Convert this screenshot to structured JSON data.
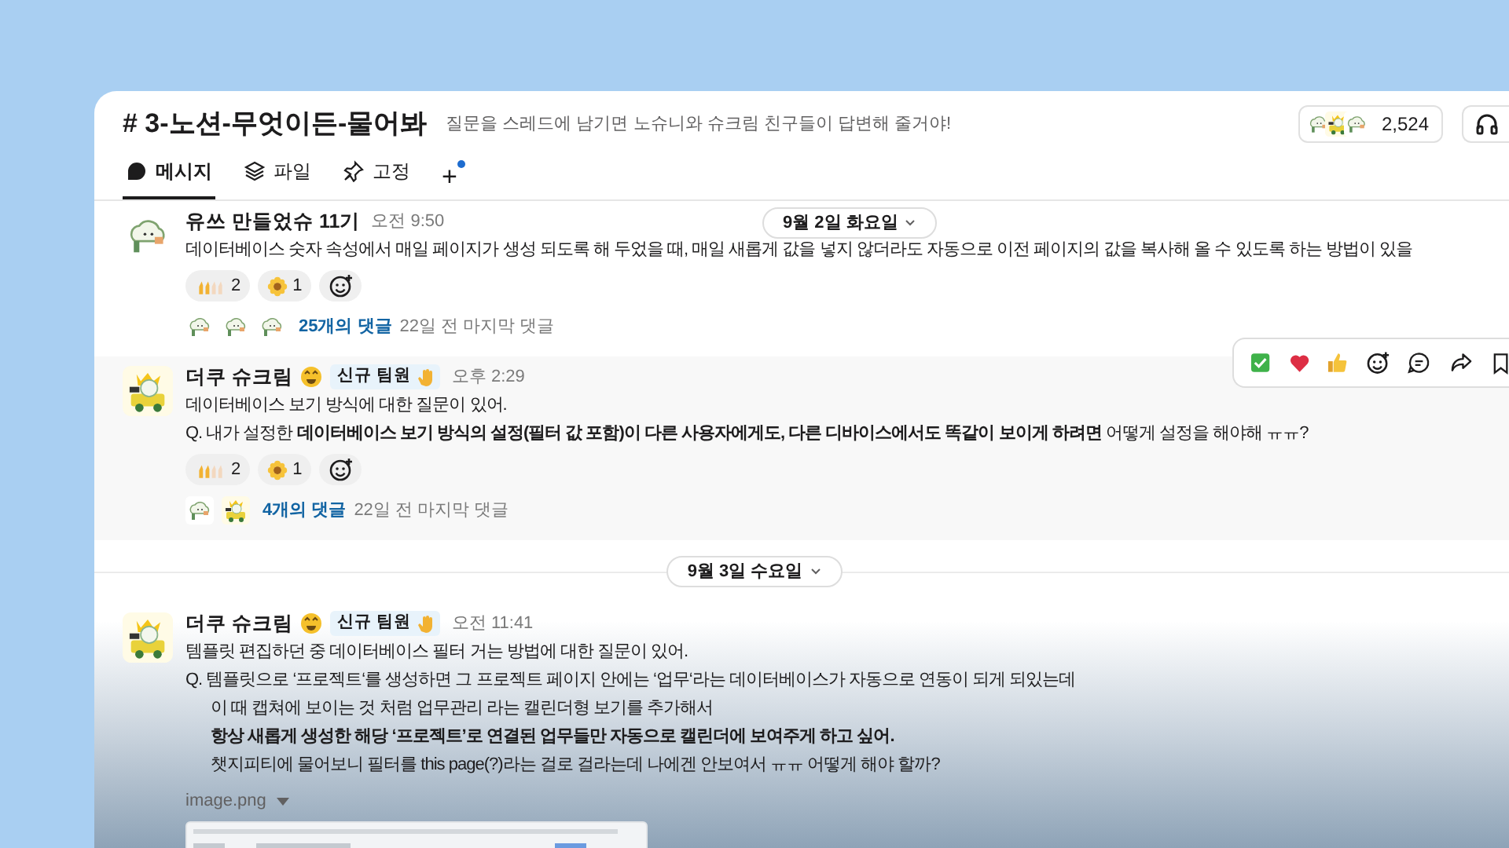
{
  "channel": {
    "title": "# 3-노션-무엇이든-물어봐",
    "description": "질문을 스레드에 남기면 노슈니와 슈크림 친구들이 답변해 줄거야!",
    "member_count": "2,524"
  },
  "tabs": [
    {
      "label": "메시지",
      "selected": true,
      "kind": "messages"
    },
    {
      "label": "파일",
      "selected": false,
      "kind": "files"
    },
    {
      "label": "고정",
      "selected": false,
      "kind": "pins"
    }
  ],
  "add_tab": {
    "label": "+",
    "unread": true
  },
  "feed": [
    {
      "kind": "date",
      "label": "9월 2일 화요일",
      "sticky": true
    },
    {
      "kind": "message",
      "author": "유쓰 만들었슈 11기",
      "time": "오전 9:50",
      "hovered": false,
      "avatar": {
        "kind": "cloud"
      },
      "lines": [
        {
          "text": "데이터베이스 숫자 속성에서 매일 페이지가 생성 되도록 해 두었을 때, 매일 새롭게 값을 넣지 않더라도 자동으로 이전 페이지의 값을 복사해 올 수 있도록 하는 방법이 있을",
          "indented": false
        }
      ],
      "reactions": [
        {
          "kind": "hands",
          "count": "2"
        },
        {
          "kind": "flower",
          "count": "1"
        }
      ],
      "thread": {
        "replies": "25개의 댓글",
        "last_reply": "22일 전 마지막 댓글",
        "avatars": [
          {
            "kind": "cloud"
          },
          {
            "kind": "cloud"
          },
          {
            "kind": "cloud"
          }
        ]
      }
    },
    {
      "kind": "message",
      "author": "더쿠 슈크림",
      "badge": "신규 팀원",
      "time": "오후 2:29",
      "hovered": true,
      "avatar": {
        "kind": "car"
      },
      "lines": [
        {
          "text": "데이터베이스 보기 방식에 대한 질문이 있어.",
          "indented": false
        },
        {
          "text": "Q. 내가 설정한 **데이터베이스 보기 방식의 설정(필터 값 포함)이 다른 사용자에게도, 다른 디바이스에서도 똑같이 보이게 하려면** 어떻게 설정을 해야해 ㅠㅠ?",
          "indented": false
        }
      ],
      "reactions": [
        {
          "kind": "hands",
          "count": "2"
        },
        {
          "kind": "flower",
          "count": "1"
        }
      ],
      "thread": {
        "replies": "4개의 댓글",
        "last_reply": "22일 전 마지막 댓글",
        "avatars": [
          {
            "kind": "cloud"
          },
          {
            "kind": "car"
          }
        ]
      }
    },
    {
      "kind": "date",
      "label": "9월 3일 수요일",
      "sticky": false
    },
    {
      "kind": "message",
      "author": "더쿠 슈크림",
      "badge": "신규 팀원",
      "time": "오전 11:41",
      "hovered": false,
      "avatar": {
        "kind": "car"
      },
      "lines": [
        {
          "text": "템플릿 편집하던 중 데이터베이스 필터 거는 방법에 대한 질문이 있어.",
          "indented": false
        },
        {
          "text": "Q. 템플릿으로 ‘프로젝트‘를 생성하면 그 프로젝트 페이지 안에는 ‘업무‘라는 데이터베이스가 자동으로 연동이 되게 되있는데",
          "indented": false
        },
        {
          "text": "이 때 캡쳐에 보이는 것 처럼 업무관리 라는 캘린더형 보기를 추가해서",
          "indented": true
        },
        {
          "text": "**항상 새롭게 생성한 해당 ‘프로젝트’로 연결된 업무들만 자동으로 캘린더에 보여주게 하고 싶어.**",
          "indented": true
        },
        {
          "text": "챗지피티에 물어보니 필터를 this page(?)라는 걸로 걸라는데 나에겐 안보여서 ㅠㅠ 어떻게 해야 할까?",
          "indented": true
        }
      ],
      "attachment": {
        "name": "image.png"
      }
    }
  ]
}
